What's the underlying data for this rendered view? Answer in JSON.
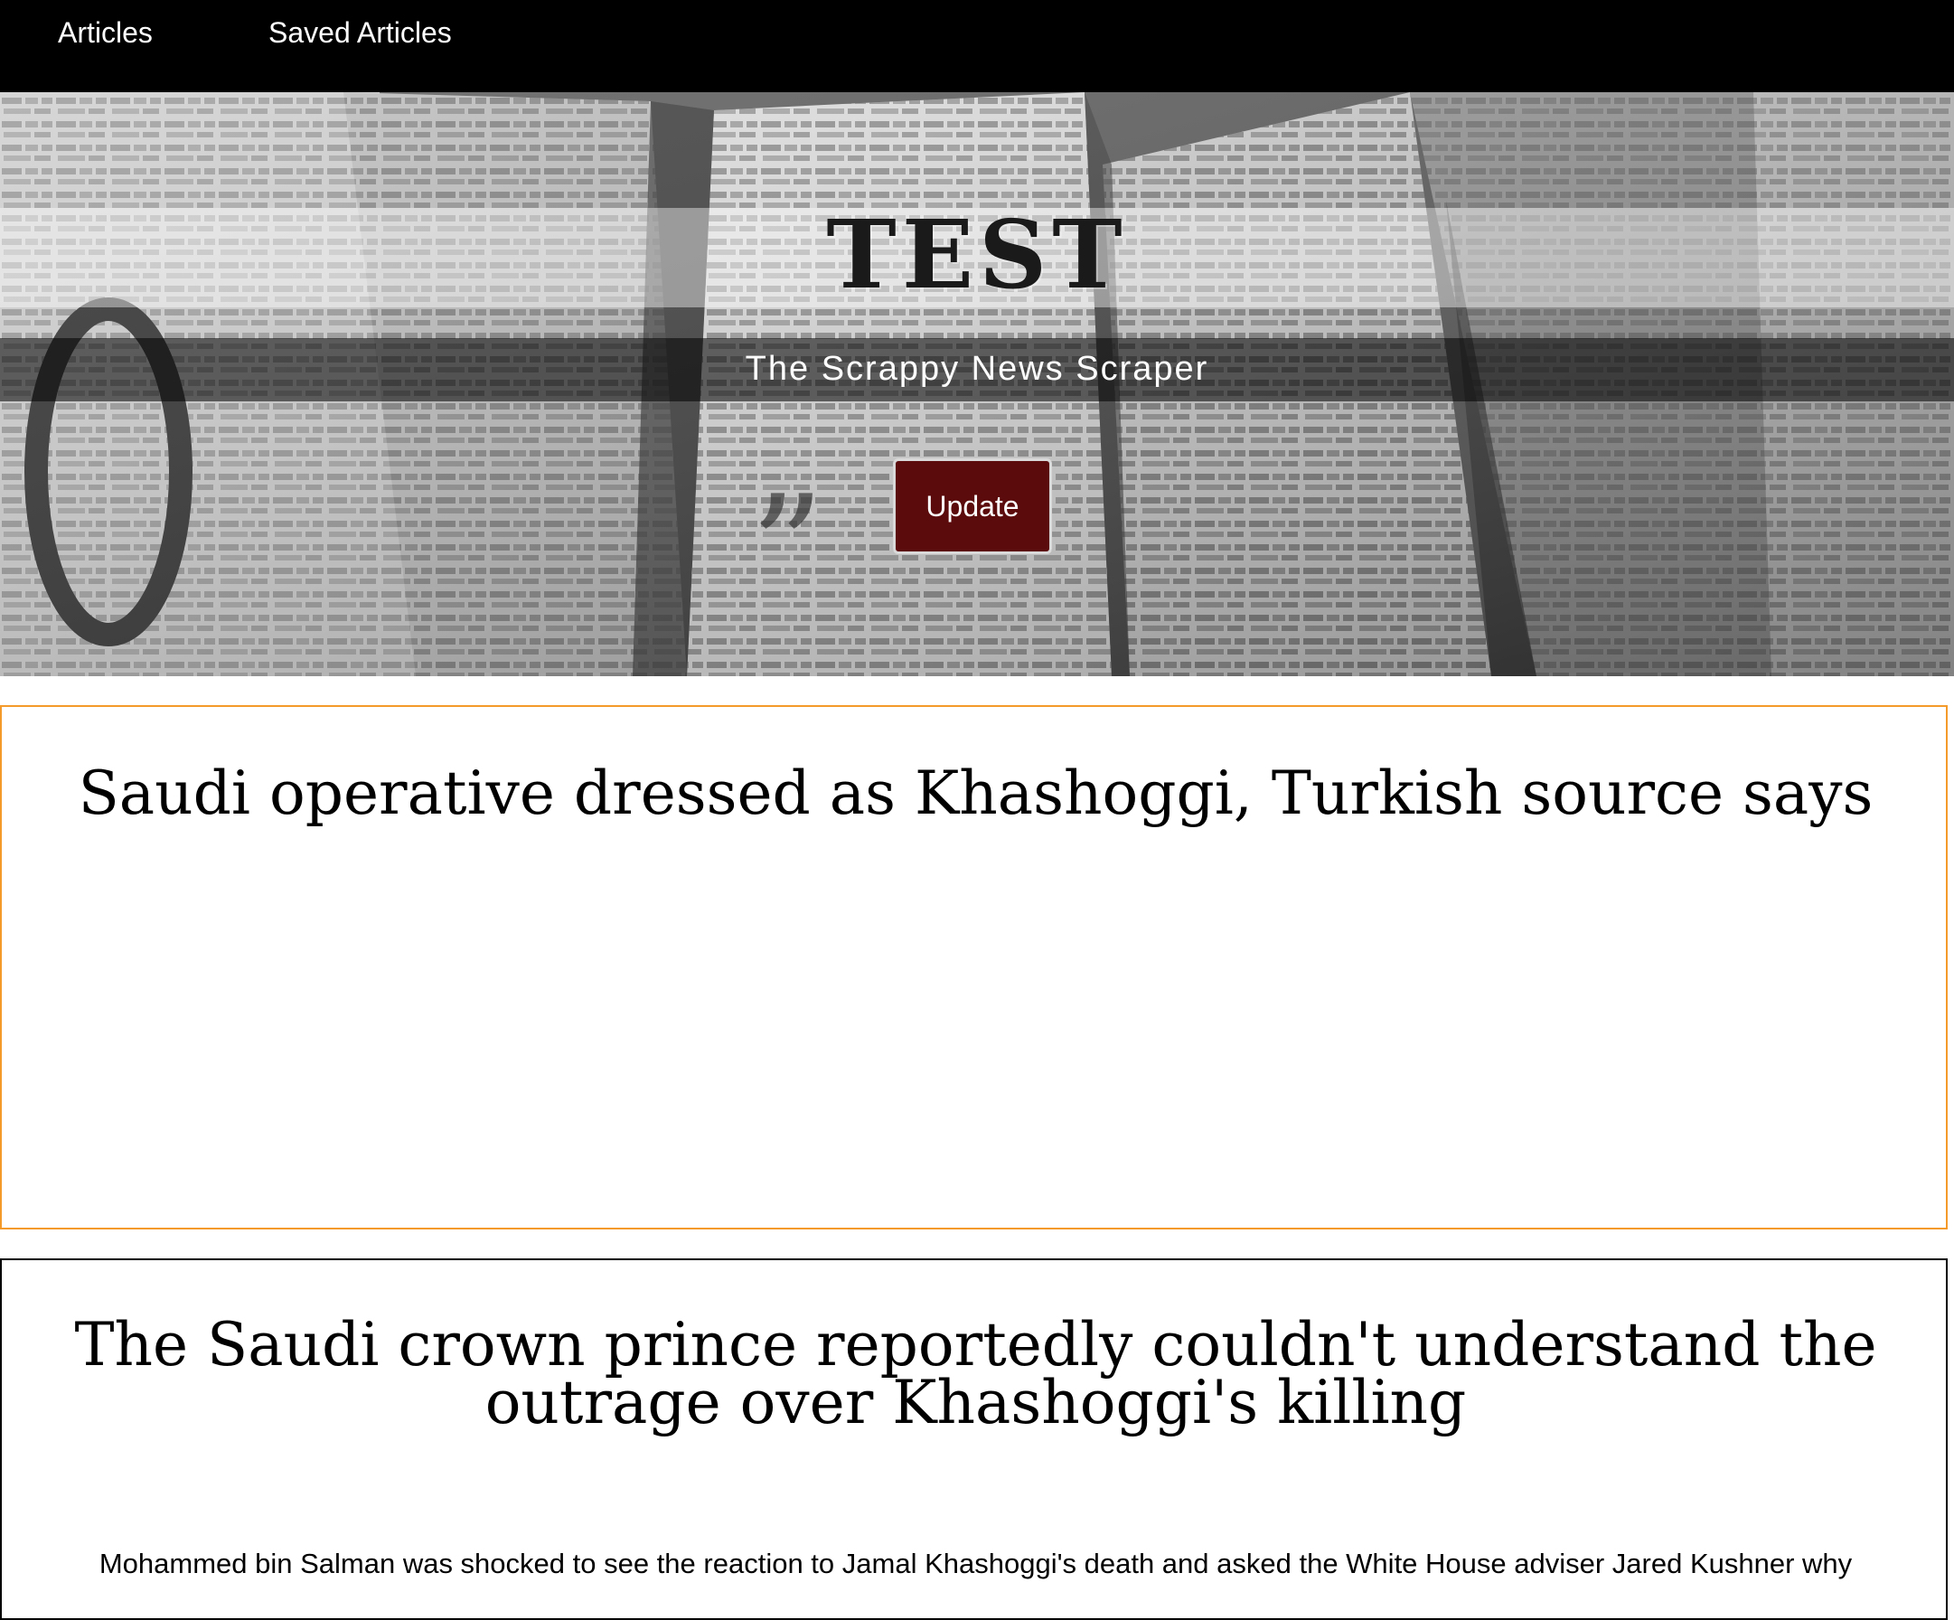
{
  "nav": {
    "items": [
      {
        "label": "Articles"
      },
      {
        "label": "Saved Articles"
      }
    ]
  },
  "hero": {
    "title": "TEST",
    "subtitle": "The Scrappy News Scraper",
    "update_label": "Update",
    "background": "newspaper-collage-image"
  },
  "articles": [
    {
      "title": "Saudi operative dressed as Khashoggi, Turkish source says",
      "summary": ""
    },
    {
      "title": "The Saudi crown prince reportedly couldn't understand the outrage over Khashoggi's killing",
      "summary": "Mohammed bin Salman was shocked to see the reaction to Jamal Khashoggi's death and asked the White House adviser Jared Kushner why"
    }
  ],
  "colors": {
    "nav_bg": "#000000",
    "button_bg": "#5c0b0d",
    "card_1_border": "#f39a2a",
    "card_2_border": "#000000"
  }
}
